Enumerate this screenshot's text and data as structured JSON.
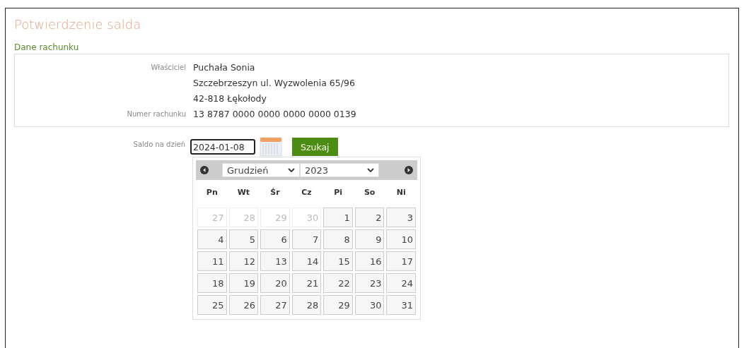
{
  "title": "Potwierdzenie salda",
  "section": "Dane rachunku",
  "account": [
    {
      "label": "Właściciel",
      "value": "Puchała Sonia"
    },
    {
      "value": "Szczebrzeszyn ul. Wyzwolenia 65/96"
    },
    {
      "value": "42-818 Łękołody"
    },
    {
      "label": "Numer rachunku",
      "value": "13 8787 0000 0000 0000 0000 0139"
    }
  ],
  "date_label": "Saldo na dzień",
  "date_value": "2024-01-08",
  "search_button": "Szukaj",
  "calendar": {
    "month": "Grudzień",
    "year": "2023",
    "weekdays": [
      "Pn",
      "Wt",
      "Śr",
      "Cz",
      "Pi",
      "So",
      "Ni"
    ],
    "days": [
      {
        "label": "27",
        "other_month": true
      },
      {
        "label": "28",
        "other_month": true
      },
      {
        "label": "29",
        "other_month": true
      },
      {
        "label": "30",
        "other_month": true
      },
      {
        "label": "1",
        "other_month": false
      },
      {
        "label": "2",
        "other_month": false
      },
      {
        "label": "3",
        "other_month": false
      },
      {
        "label": "4",
        "other_month": false
      },
      {
        "label": "5",
        "other_month": false
      },
      {
        "label": "6",
        "other_month": false
      },
      {
        "label": "7",
        "other_month": false
      },
      {
        "label": "8",
        "other_month": false
      },
      {
        "label": "9",
        "other_month": false
      },
      {
        "label": "10",
        "other_month": false
      },
      {
        "label": "11",
        "other_month": false
      },
      {
        "label": "12",
        "other_month": false
      },
      {
        "label": "13",
        "other_month": false
      },
      {
        "label": "14",
        "other_month": false
      },
      {
        "label": "15",
        "other_month": false
      },
      {
        "label": "16",
        "other_month": false
      },
      {
        "label": "17",
        "other_month": false
      },
      {
        "label": "18",
        "other_month": false
      },
      {
        "label": "19",
        "other_month": false
      },
      {
        "label": "20",
        "other_month": false
      },
      {
        "label": "21",
        "other_month": false
      },
      {
        "label": "22",
        "other_month": false
      },
      {
        "label": "23",
        "other_month": false
      },
      {
        "label": "24",
        "other_month": false
      },
      {
        "label": "25",
        "other_month": false
      },
      {
        "label": "26",
        "other_month": false
      },
      {
        "label": "27",
        "other_month": false
      },
      {
        "label": "28",
        "other_month": false
      },
      {
        "label": "29",
        "other_month": false
      },
      {
        "label": "30",
        "other_month": false
      },
      {
        "label": "31",
        "other_month": false
      }
    ]
  }
}
